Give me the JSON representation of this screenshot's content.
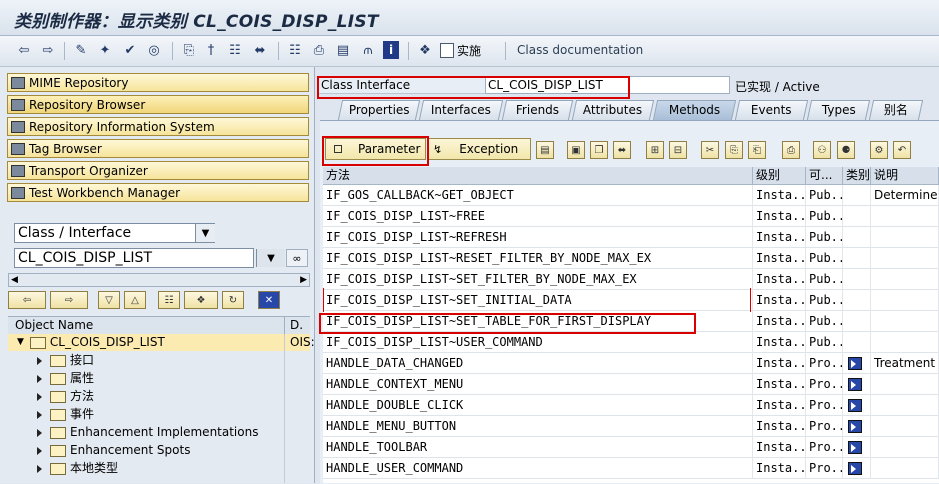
{
  "window": {
    "title": "类别制作器：显示类别 CL_COIS_DISP_LIST"
  },
  "toolbar": {
    "implement_label": "实施",
    "class_doc_label": "Class documentation"
  },
  "nav_buttons": [
    {
      "label": "MIME Repository"
    },
    {
      "label": "Repository Browser"
    },
    {
      "label": "Repository Information System"
    },
    {
      "label": "Tag Browser"
    },
    {
      "label": "Transport Organizer"
    },
    {
      "label": "Test Workbench Manager"
    }
  ],
  "object_type": {
    "value": "Class / Interface"
  },
  "object_name": {
    "value": "CL_COIS_DISP_LIST"
  },
  "tree": {
    "header_name": "Object Name",
    "header_desc": "D.",
    "root": {
      "label": "CL_COIS_DISP_LIST",
      "desc": "OIS:"
    },
    "children": [
      "接口",
      "属性",
      "方法",
      "事件",
      "Enhancement Implementations",
      "Enhancement Spots",
      "本地类型"
    ]
  },
  "header": {
    "label": "Class Interface",
    "value": "CL_COIS_DISP_LIST",
    "status": "已实现 / Active"
  },
  "tabs": [
    "Properties",
    "Interfaces",
    "Friends",
    "Attributes",
    "Methods",
    "Events",
    "Types",
    "别名"
  ],
  "active_tab": "Methods",
  "method_toolbar": {
    "parameter_label": "Parameter",
    "exception_label": "Exception"
  },
  "grid": {
    "columns": [
      "方法",
      "级别",
      "可...",
      "类别",
      "说明"
    ],
    "rows": [
      {
        "method": "IF_GOS_CALLBACK~GET_OBJECT",
        "level": "Insta...",
        "vis": "Pub...",
        "event": false,
        "desc": "Determine B"
      },
      {
        "method": "IF_COIS_DISP_LIST~FREE",
        "level": "Insta...",
        "vis": "Pub...",
        "event": false,
        "desc": ""
      },
      {
        "method": "IF_COIS_DISP_LIST~REFRESH",
        "level": "Insta...",
        "vis": "Pub...",
        "event": false,
        "desc": ""
      },
      {
        "method": "IF_COIS_DISP_LIST~RESET_FILTER_BY_NODE_MAX_EX",
        "level": "Insta...",
        "vis": "Pub...",
        "event": false,
        "desc": ""
      },
      {
        "method": "IF_COIS_DISP_LIST~SET_FILTER_BY_NODE_MAX_EX",
        "level": "Insta...",
        "vis": "Pub...",
        "event": false,
        "desc": ""
      },
      {
        "method": "IF_COIS_DISP_LIST~SET_INITIAL_DATA",
        "level": "Insta...",
        "vis": "Pub...",
        "event": false,
        "desc": ""
      },
      {
        "method": "IF_COIS_DISP_LIST~SET_TABLE_FOR_FIRST_DISPLAY",
        "level": "Insta...",
        "vis": "Pub...",
        "event": false,
        "desc": ""
      },
      {
        "method": "IF_COIS_DISP_LIST~USER_COMMAND",
        "level": "Insta...",
        "vis": "Pub...",
        "event": false,
        "desc": ""
      },
      {
        "method": "HANDLE_DATA_CHANGED",
        "level": "Insta...",
        "vis": "Pro...",
        "event": true,
        "desc": "Treatment o"
      },
      {
        "method": "HANDLE_CONTEXT_MENU",
        "level": "Insta...",
        "vis": "Pro...",
        "event": true,
        "desc": ""
      },
      {
        "method": "HANDLE_DOUBLE_CLICK",
        "level": "Insta...",
        "vis": "Pro...",
        "event": true,
        "desc": ""
      },
      {
        "method": "HANDLE_MENU_BUTTON",
        "level": "Insta...",
        "vis": "Pro...",
        "event": true,
        "desc": ""
      },
      {
        "method": "HANDLE_TOOLBAR",
        "level": "Insta...",
        "vis": "Pro...",
        "event": true,
        "desc": ""
      },
      {
        "method": "HANDLE_USER_COMMAND",
        "level": "Insta...",
        "vis": "Pro...",
        "event": true,
        "desc": ""
      }
    ]
  },
  "colors": {
    "highlight": "#d90000",
    "nav_button": "#f6e49a",
    "accent_blue": "#2748a8"
  }
}
